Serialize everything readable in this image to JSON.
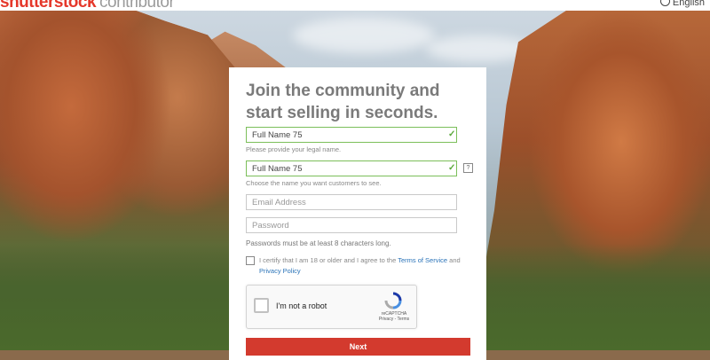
{
  "header": {
    "logo_brand": "shutterstock",
    "logo_product": "contributor",
    "language": "English"
  },
  "signup": {
    "headline": "Join the community and start selling in seconds.",
    "full_name": {
      "value": "Full Name 75",
      "hint": "Please provide your legal name."
    },
    "display_name": {
      "value": "Full Name 75",
      "hint": "Choose the name you want customers to see.",
      "help": "?"
    },
    "email": {
      "placeholder": "Email Address"
    },
    "password": {
      "placeholder": "Password",
      "note": "Passwords must be at least 8 characters long."
    },
    "certify": {
      "text": "I certify that I am 18 or older and I agree to the",
      "terms_link": "Terms of Service",
      "and": "and",
      "privacy_link": "Privacy Policy"
    },
    "captcha": {
      "label": "I'm not a robot",
      "brand": "reCAPTCHA",
      "links": "Privacy - Terms"
    },
    "next_label": "Next"
  },
  "colors": {
    "brand_red": "#e5372a",
    "button_red": "#d33a2e",
    "valid_green": "#5aa83a",
    "link_blue": "#2a73b8"
  }
}
